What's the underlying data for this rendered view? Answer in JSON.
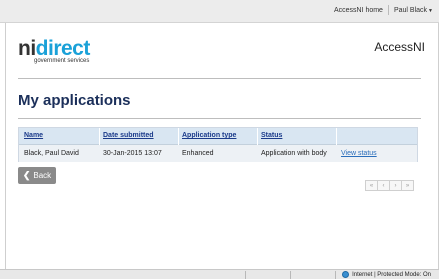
{
  "topnav": {
    "home_link": "AccessNI home",
    "user_menu": "Paul Black"
  },
  "logo": {
    "part1": "ni",
    "part2": "direct",
    "subtitle": "government services"
  },
  "service_name": "AccessNI",
  "page_title": "My applications",
  "table": {
    "headers": [
      "Name",
      "Date submitted",
      "Application type",
      "Status"
    ],
    "rows": [
      {
        "name": "Black, Paul David",
        "date": "30-Jan-2015 13:07",
        "type": "Enhanced",
        "status": "Application with body",
        "action": "View status"
      }
    ]
  },
  "back_button": "Back",
  "pager": [
    "«",
    "‹",
    "›",
    "»"
  ],
  "statusbar": {
    "zone": "Internet | Protected Mode: On"
  },
  "colors": {
    "logo_blue": "#1aa1d8",
    "title_navy": "#1b2f5a",
    "link_blue": "#2a6ebb"
  },
  "icons": {
    "back": "chevron-left-icon",
    "user_menu": "caret-down-icon",
    "zone": "globe-icon"
  }
}
